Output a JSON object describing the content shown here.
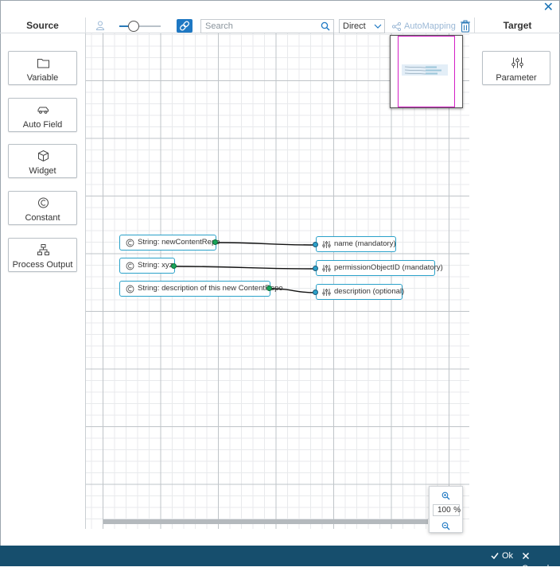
{
  "window": {
    "close_icon": "close-icon"
  },
  "columns": {
    "source": "Source",
    "target": "Target"
  },
  "toolbar": {
    "search_placeholder": "Search",
    "mapping_mode": "Direct",
    "automapping_label": "AutoMapping"
  },
  "source_items": [
    {
      "label": "Variable",
      "icon": "folder-icon"
    },
    {
      "label": "Auto Field",
      "icon": "car-icon"
    },
    {
      "label": "Widget",
      "icon": "cube-icon"
    },
    {
      "label": "Constant",
      "icon": "constant-icon"
    },
    {
      "label": "Process Output",
      "icon": "process-tree-icon"
    }
  ],
  "target_items": [
    {
      "label": "Parameter",
      "icon": "sliders-icon"
    }
  ],
  "source_nodes": [
    {
      "label": "String: newContentRepo"
    },
    {
      "label": "String: xyz"
    },
    {
      "label": "String: description of this new ContentRepo"
    }
  ],
  "target_nodes": [
    {
      "label": "name (mandatory)"
    },
    {
      "label": "permissionObjectID (mandatory)"
    },
    {
      "label": "description (optional)"
    }
  ],
  "zoom": {
    "value": "100",
    "unit": "%"
  },
  "footer": {
    "ok_label": "Ok",
    "cancel_label": "Cancel"
  },
  "colors": {
    "footer_bg": "#164e6d",
    "accent": "#1e78c3",
    "node_border": "#2aa1c9",
    "minimap_view": "#d41fc6"
  }
}
